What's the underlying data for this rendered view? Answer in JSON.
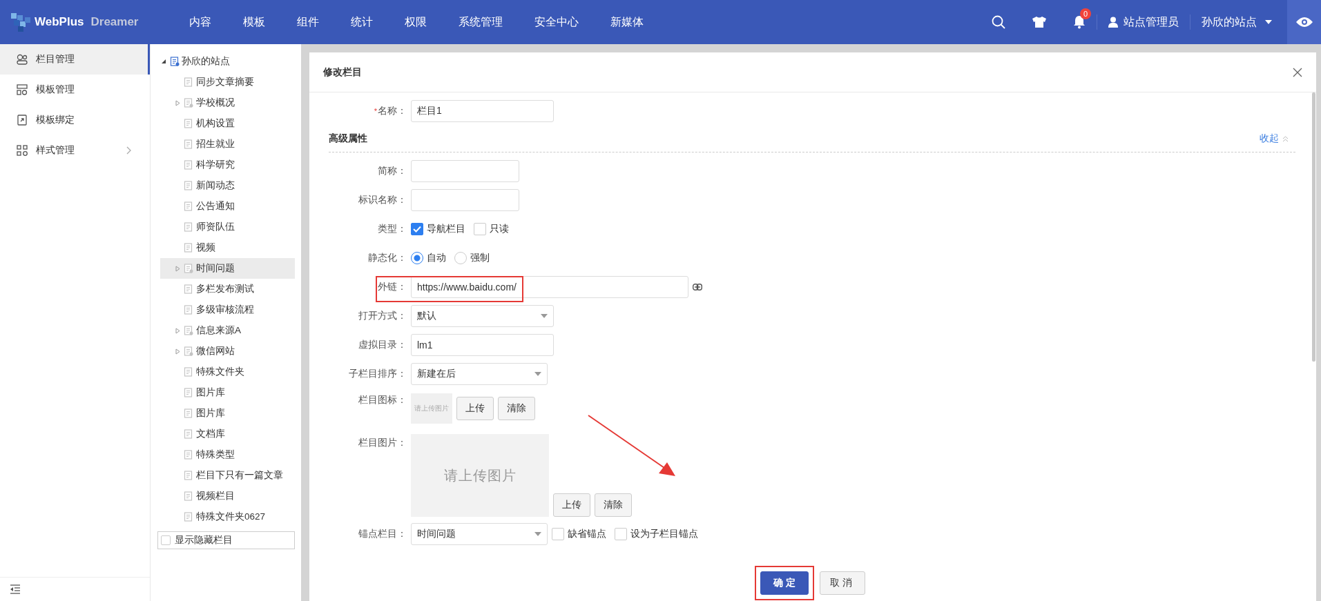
{
  "header": {
    "logo": {
      "brand": "WebPlus",
      "product": "Dreamer"
    },
    "nav": [
      {
        "label": "内容",
        "selected": false
      },
      {
        "label": "模板",
        "selected": false
      },
      {
        "label": "组件",
        "selected": false
      },
      {
        "label": "统计",
        "selected": false
      },
      {
        "label": "权限",
        "selected": false
      },
      {
        "label": "系统管理",
        "selected": false
      },
      {
        "label": "安全中心",
        "selected": false
      },
      {
        "label": "新媒体",
        "selected": false
      }
    ],
    "notifications": "0",
    "user": "站点管理员",
    "site": "孙欣的站点"
  },
  "sidebar": {
    "items": [
      {
        "label": "栏目管理",
        "selected": true,
        "has_submenu": false
      },
      {
        "label": "模板管理",
        "selected": false,
        "has_submenu": false
      },
      {
        "label": "模板绑定",
        "selected": false,
        "has_submenu": false
      },
      {
        "label": "样式管理",
        "selected": false,
        "has_submenu": true
      }
    ]
  },
  "tree": {
    "root": {
      "label": "孙欣的站点",
      "expanded": true,
      "children": [
        {
          "label": "同步文章摘要",
          "selected": false,
          "has_children": false
        },
        {
          "label": "学校概况",
          "selected": false,
          "has_children": true
        },
        {
          "label": "机构设置",
          "selected": false,
          "has_children": false
        },
        {
          "label": "招生就业",
          "selected": false,
          "has_children": false
        },
        {
          "label": "科学研究",
          "selected": false,
          "has_children": false
        },
        {
          "label": "新闻动态",
          "selected": false,
          "has_children": false
        },
        {
          "label": "公告通知",
          "selected": false,
          "has_children": false
        },
        {
          "label": "师资队伍",
          "selected": false,
          "has_children": false
        },
        {
          "label": "视频",
          "selected": false,
          "has_children": false
        },
        {
          "label": "时间问题",
          "selected": true,
          "has_children": true
        },
        {
          "label": "多栏发布测试",
          "selected": false,
          "has_children": false
        },
        {
          "label": "多级审核流程",
          "selected": false,
          "has_children": false
        },
        {
          "label": "信息来源A",
          "selected": false,
          "has_children": true
        },
        {
          "label": "微信网站",
          "selected": false,
          "has_children": true
        },
        {
          "label": "特殊文件夹",
          "selected": false,
          "has_children": false
        },
        {
          "label": "图片库",
          "selected": false,
          "has_children": false
        },
        {
          "label": "图片库",
          "selected": false,
          "has_children": false
        },
        {
          "label": "文档库",
          "selected": false,
          "has_children": false
        },
        {
          "label": "特殊类型",
          "selected": false,
          "has_children": false
        },
        {
          "label": "栏目下只有一篇文章",
          "selected": false,
          "has_children": false
        },
        {
          "label": "视频栏目",
          "selected": false,
          "has_children": false
        },
        {
          "label": "特殊文件夹0627",
          "selected": false,
          "has_children": false
        }
      ]
    },
    "show_hidden": {
      "label": "显示隐藏栏目",
      "checked": false
    }
  },
  "dialog": {
    "title": "修改栏目",
    "arrow": true,
    "name_field": {
      "label": "名称：",
      "required_mark": "*",
      "value": "栏目1"
    },
    "advanced": {
      "title": "高级属性",
      "toggle": "收起",
      "expanded": true,
      "fields": [
        {
          "kind": "short-text",
          "label": "简称："
        },
        {
          "kind": "short-text",
          "label": "标识名称："
        },
        {
          "kind": "checkboxes",
          "label": "类型：",
          "options": [
            {
              "label": "导航栏目",
              "checked": true
            },
            {
              "label": "只读",
              "checked": false
            }
          ]
        },
        {
          "kind": "radios",
          "label": "静态化：",
          "options": [
            {
              "label": "自动",
              "selected": true
            },
            {
              "label": "强制",
              "selected": false
            }
          ]
        },
        {
          "kind": "link",
          "label": "外链：",
          "value": "https://www.baidu.com/",
          "highlighted": true
        },
        {
          "kind": "select",
          "label": "打开方式：",
          "value": "默认"
        },
        {
          "kind": "text",
          "label": "虚拟目录：",
          "value": "lm1"
        },
        {
          "kind": "select",
          "label": "子栏目排序：",
          "value": "新建在后"
        },
        {
          "kind": "icon-upload",
          "label": "栏目图标：",
          "placeholder": "请上传图片",
          "buttons": [
            "上传",
            "清除"
          ]
        },
        {
          "kind": "image-upload",
          "label": "栏目图片：",
          "placeholder": "请上传图片",
          "buttons": [
            "上传",
            "清除"
          ]
        },
        {
          "kind": "anchor",
          "label": "锚点栏目：",
          "value": "时间问题",
          "options": [
            {
              "label": "缺省锚点",
              "checked": false
            },
            {
              "label": "设为子栏目锚点",
              "checked": false
            }
          ]
        }
      ]
    },
    "buttons": [
      {
        "label": "确定",
        "kind": "primary",
        "highlighted": true
      },
      {
        "label": "取消",
        "kind": "default",
        "highlighted": false
      }
    ]
  }
}
